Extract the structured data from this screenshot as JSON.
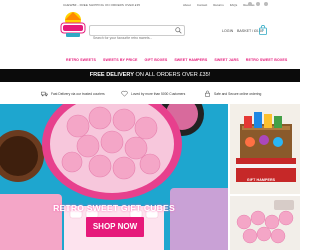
{
  "topbar": {
    "tagline": "CHEWBZ - FREE SHIPPING ON ORDERS OVER £35",
    "links": [
      "About",
      "Contact",
      "Returns",
      "FAQs",
      "Reviews"
    ]
  },
  "brand": {
    "logo_text": "Chewbz"
  },
  "header": {
    "search_placeholder": "Search for your favourite retro sweets...",
    "login": "LOGIN",
    "basket": "BASKET / £0.00",
    "basket_count": "0"
  },
  "nav": {
    "items": [
      "RETRO SWEETS",
      "SWEETS BY PRICE",
      "GIFT BOXES",
      "SWEET HAMPERS",
      "SWEET JARS",
      "RETRO SWEET BOXES"
    ]
  },
  "delivery_banner": {
    "bold": "FREE DELIVERY",
    "rest": "ON ALL ORDERS OVER £35!"
  },
  "usps": [
    "Fast Delivery via our trusted couriers",
    "Loved by more than 5000 Customers",
    "Safe and Secure online ordering"
  ],
  "hero": {
    "title": "RETRO SWEET GIFT CUBES",
    "button": "SHOP NOW"
  },
  "promo": {
    "label": "GIFT HAMPERS"
  },
  "colors": {
    "accent_pink": "#e6197a",
    "hero_blue": "#1ea6cf",
    "banner_black": "#0b0b0b"
  }
}
